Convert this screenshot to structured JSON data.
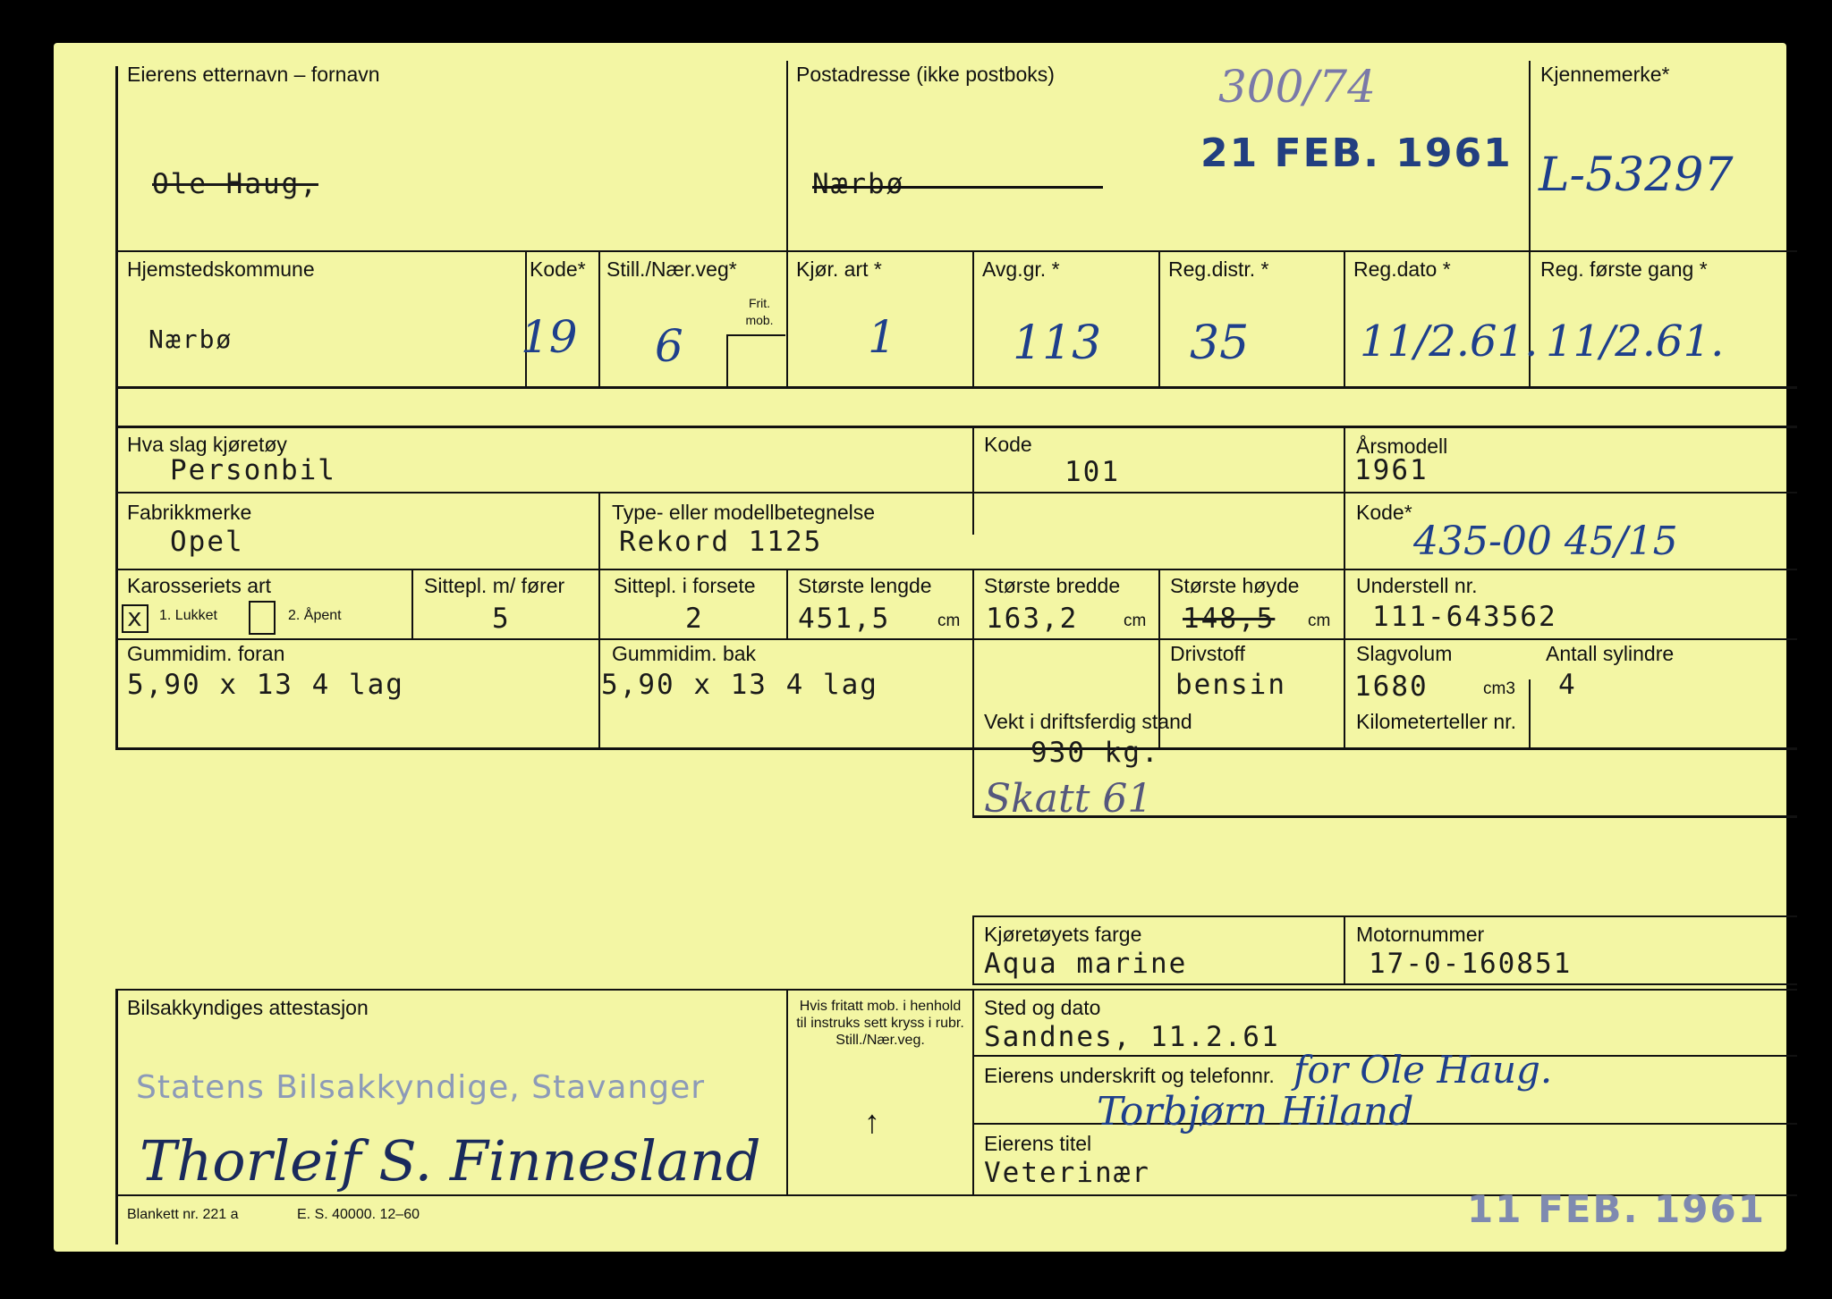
{
  "owner": {
    "name_label": "Eierens etternavn – fornavn",
    "name_value": "Ole Haug,",
    "address_label": "Postadresse (ikke postboks)",
    "address_value": "Nærbø",
    "reg_mark_label": "Kjennemerke*",
    "reg_mark_value": "L-53297",
    "file_number": "300/74",
    "received_stamp": "21 FEB. 1961"
  },
  "registration": {
    "home_municipality_label": "Hjemstedskommune",
    "home_municipality_value": "Nærbø",
    "code_label": "Kode*",
    "code_value": "19",
    "still_label": "Still./Nær.veg*",
    "still_value": "6",
    "frit_mob_label": "Frit. mob.",
    "vehicle_type_label": "Kjør. art *",
    "vehicle_type_value": "1",
    "fee_group_label": "Avg.gr. *",
    "fee_group_value": "113",
    "reg_district_label": "Reg.distr. *",
    "reg_district_value": "35",
    "reg_date_label": "Reg.dato *",
    "reg_date_value": "11/2.61.",
    "first_reg_label": "Reg. første gang *",
    "first_reg_value": "11/2.61."
  },
  "vehicle": {
    "kind_label": "Hva slag kjøretøy",
    "kind_value": "Personbil",
    "kind_code_label": "Kode",
    "kind_code_value": "101",
    "model_year_label": "Årsmodell",
    "model_year_value": "1961",
    "make_label": "Fabrikkmerke",
    "make_value": "Opel",
    "model_label": "Type- eller modellbetegnelse",
    "model_value": "Rekord 1125",
    "model_code_label": "Kode*",
    "model_code_value": "435-00 45/15",
    "body_label": "Karosseriets art",
    "body_closed_mark": "x",
    "body_closed_label": "1. Lukket",
    "body_open_label": "2. Åpent",
    "seats_label": "Sittepl. m/ fører",
    "seats_value": "5",
    "front_seats_label": "Sittepl. i forsete",
    "front_seats_value": "2",
    "length_label": "Største lengde",
    "length_value": "451,5",
    "width_label": "Største bredde",
    "width_value": "163,2",
    "height_label": "Største høyde",
    "height_value": "148,5",
    "cm_unit": "cm",
    "chassis_label": "Understell nr.",
    "chassis_value": "111-643562",
    "tyre_front_label": "Gummidim. foran",
    "tyre_front_value": "5,90 x 13 4 lag",
    "tyre_rear_label": "Gummidim. bak",
    "tyre_rear_value": "5,90 x 13 4 lag",
    "fuel_label": "Drivstoff",
    "fuel_value": "bensin",
    "displacement_label": "Slagvolum",
    "displacement_value": "1680",
    "displacement_unit": "cm3",
    "cylinders_label": "Antall sylindre",
    "cylinders_value": "4",
    "weight_label": "Vekt i driftsferdig stand",
    "weight_value": "930 kg.",
    "odometer_label": "Kilometerteller nr.",
    "tax_note": "Skatt 61",
    "colour_label": "Kjøretøyets farge",
    "colour_value": "Aqua marine",
    "engine_label": "Motornummer",
    "engine_value": "17-0-160851"
  },
  "attestation": {
    "label": "Bilsakkyndiges attestasjon",
    "stamp": "Statens Bilsakkyndige, Stavanger",
    "signature": "Thorleif S. Finnesland",
    "instructions": "Hvis fritatt mob. i henhold til instruks sett kryss i rubr. Still./Nær.veg.",
    "arrow": "↑",
    "place_date_label": "Sted og dato",
    "place_date_value": "Sandnes, 11.2.61",
    "owner_signature_label": "Eierens underskrift og telefonnr.",
    "owner_signature_line1": "for Ole Haug.",
    "owner_signature_line2": "Torbjørn Hiland",
    "owner_title_label": "Eierens titel",
    "owner_title_value": "Veterinær",
    "form_number": "Blankett nr. 221 a",
    "print_info": "E. S. 40000. 12–60",
    "bottom_stamp": "11 FEB. 1961"
  },
  "colors": {
    "card": "#f3f6a4",
    "ink": "#1e3f8c",
    "stamp": "#223f80"
  }
}
